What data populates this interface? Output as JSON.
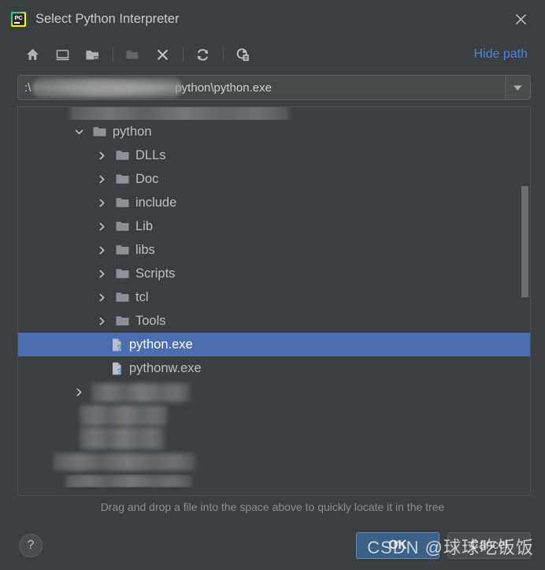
{
  "window": {
    "title": "Select Python Interpreter",
    "app_icon": "pycharm-icon",
    "close_icon": "close-icon"
  },
  "toolbar": {
    "buttons": [
      {
        "name": "home-icon",
        "label": "Home",
        "enabled": true
      },
      {
        "name": "desktop-icon",
        "label": "Desktop",
        "enabled": true
      },
      {
        "name": "project-folder-icon",
        "label": "Project Directory",
        "enabled": true
      },
      {
        "name": "new-folder-icon",
        "label": "New Folder",
        "enabled": false
      },
      {
        "name": "delete-icon",
        "label": "Delete",
        "enabled": true
      },
      {
        "name": "refresh-icon",
        "label": "Refresh",
        "enabled": true
      },
      {
        "name": "show-hidden-icon",
        "label": "Show Hidden Files",
        "enabled": true
      }
    ],
    "hide_path_label": "Hide path",
    "hide_path_color": "#4d86d6"
  },
  "path_field": {
    "value_visible": "python\\python.exe",
    "prefix_visible": ":\\",
    "redacted": true,
    "dropdown_icon": "chevron-down-icon"
  },
  "tree": {
    "rows": [
      {
        "type": "redacted",
        "indent": 1,
        "arrow": "collapsed",
        "label": ""
      },
      {
        "type": "folder",
        "indent": 1,
        "arrow": "expanded",
        "label": "python"
      },
      {
        "type": "folder",
        "indent": 2,
        "arrow": "collapsed",
        "label": "DLLs"
      },
      {
        "type": "folder",
        "indent": 2,
        "arrow": "collapsed",
        "label": "Doc"
      },
      {
        "type": "folder",
        "indent": 2,
        "arrow": "collapsed",
        "label": "include"
      },
      {
        "type": "folder",
        "indent": 2,
        "arrow": "collapsed",
        "label": "Lib"
      },
      {
        "type": "folder",
        "indent": 2,
        "arrow": "collapsed",
        "label": "libs"
      },
      {
        "type": "folder",
        "indent": 2,
        "arrow": "collapsed",
        "label": "Scripts"
      },
      {
        "type": "folder",
        "indent": 2,
        "arrow": "collapsed",
        "label": "tcl"
      },
      {
        "type": "folder",
        "indent": 2,
        "arrow": "collapsed",
        "label": "Tools"
      },
      {
        "type": "file",
        "indent": 2,
        "arrow": "none",
        "label": "python.exe",
        "selected": true
      },
      {
        "type": "file",
        "indent": 2,
        "arrow": "none",
        "label": "pythonw.exe"
      },
      {
        "type": "redacted",
        "indent": 1,
        "arrow": "collapsed",
        "label": ""
      },
      {
        "type": "redacted",
        "indent": 2,
        "arrow": "none",
        "label": ""
      },
      {
        "type": "redacted",
        "indent": 2,
        "arrow": "none",
        "label": ""
      },
      {
        "type": "redacted",
        "indent": 1,
        "arrow": "none",
        "label": ""
      },
      {
        "type": "redacted",
        "indent": 1,
        "arrow": "collapsed",
        "label": ""
      }
    ],
    "selected_index": 10,
    "selection_color": "#4b6eaf",
    "scrollbar": {
      "thumb_top_pct": 20,
      "thumb_height_pct": 29
    }
  },
  "hint": {
    "text": "Drag and drop a file into the space above to quickly locate it in the tree"
  },
  "footer": {
    "help_label": "?",
    "ok_label": "OK",
    "cancel_label": "Cancel",
    "ok_color": "#3d6185"
  },
  "watermark": {
    "text": "CSDN @球球吃饭饭"
  }
}
